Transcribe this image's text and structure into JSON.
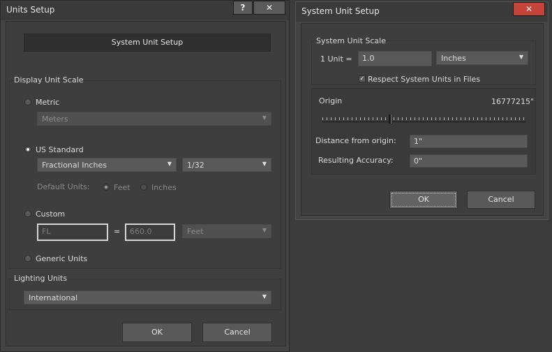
{
  "units_setup": {
    "title": "Units Setup",
    "help_label": "?",
    "close_label": "✕",
    "system_unit_setup_button": "System Unit Setup",
    "display_unit_scale": {
      "label": "Display Unit Scale",
      "metric": {
        "label": "Metric",
        "selected": false,
        "dropdown": "Meters"
      },
      "us_standard": {
        "label": "US Standard",
        "selected": true,
        "units_dropdown": "Fractional Inches",
        "fraction_dropdown": "1/32",
        "default_units_label": "Default Units:",
        "feet_label": "Feet",
        "inches_label": "Inches",
        "default_selected": "Feet"
      },
      "custom": {
        "label": "Custom",
        "selected": false,
        "name_value": "FL",
        "equals": "=",
        "amount_value": "660.0",
        "unit_dropdown": "Feet"
      },
      "generic": {
        "label": "Generic Units",
        "selected": false
      }
    },
    "lighting_units": {
      "label": "Lighting Units",
      "dropdown": "International"
    },
    "ok_label": "OK",
    "cancel_label": "Cancel"
  },
  "system_unit_setup": {
    "title": "System Unit Setup",
    "close_label": "✕",
    "scale_group_label": "System Unit Scale",
    "unit_label": "1 Unit =",
    "unit_value": "1.0",
    "unit_type": "Inches",
    "respect_label": "Respect System Units in Files",
    "respect_checked": true,
    "origin_label": "Origin",
    "origin_value": "16777215\"",
    "distance_label": "Distance from origin:",
    "distance_value": "1\"",
    "accuracy_label": "Resulting Accuracy:",
    "accuracy_value": "0\"",
    "ok_label": "OK",
    "cancel_label": "Cancel"
  },
  "icons": {
    "dropdown_arrow": "chevron-down-icon",
    "check": "check-icon"
  }
}
